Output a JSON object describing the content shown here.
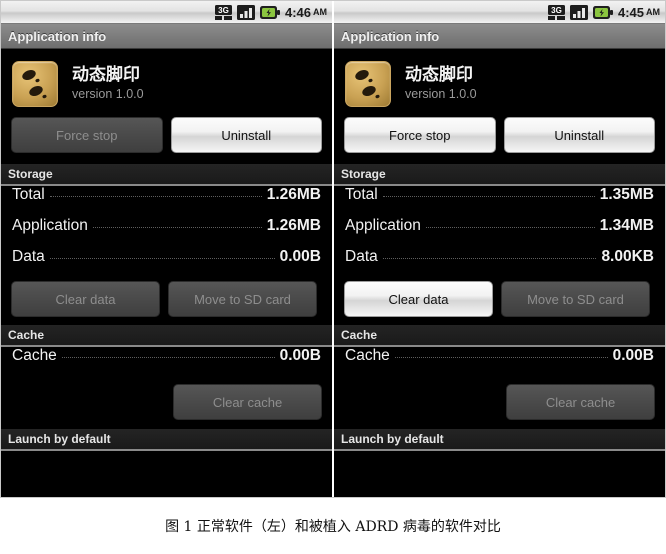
{
  "caption": {
    "text": "图 1 正常软件（左）和被植入 ADRD 病毒的软件对比",
    "figure_number": "图 1",
    "virus_name": "ADRD"
  },
  "panels": [
    {
      "role": "clean-app",
      "statusbar": {
        "network_icon": "3g-icon",
        "signal_icon": "signal-bars-icon",
        "battery_icon": "battery-charging-icon",
        "time": "4:46",
        "ampm": "AM"
      },
      "titlebar": {
        "title": "Application info"
      },
      "app": {
        "icon": "footprint-app-icon",
        "name": "动态脚印",
        "version": "version 1.0.0"
      },
      "actions": [
        {
          "label": "Force stop",
          "enabled": false
        },
        {
          "label": "Uninstall",
          "enabled": true
        }
      ],
      "storage": {
        "header": "Storage",
        "rows": [
          {
            "label": "Total",
            "value": "1.26MB"
          },
          {
            "label": "Application",
            "value": "1.26MB"
          },
          {
            "label": "Data",
            "value": "0.00B"
          }
        ],
        "buttons": [
          {
            "label": "Clear data",
            "enabled": false
          },
          {
            "label": "Move to SD card",
            "enabled": false
          }
        ]
      },
      "cache": {
        "header": "Cache",
        "rows": [
          {
            "label": "Cache",
            "value": "0.00B"
          }
        ],
        "buttons": [
          {
            "label": "Clear cache",
            "enabled": false
          }
        ]
      },
      "launch": {
        "header": "Launch by default"
      }
    },
    {
      "role": "infected-app",
      "statusbar": {
        "network_icon": "3g-icon",
        "signal_icon": "signal-bars-icon",
        "battery_icon": "battery-charging-icon",
        "time": "4:45",
        "ampm": "AM"
      },
      "titlebar": {
        "title": "Application info"
      },
      "app": {
        "icon": "footprint-app-icon",
        "name": "动态脚印",
        "version": "version 1.0.0"
      },
      "actions": [
        {
          "label": "Force stop",
          "enabled": true
        },
        {
          "label": "Uninstall",
          "enabled": true
        }
      ],
      "storage": {
        "header": "Storage",
        "rows": [
          {
            "label": "Total",
            "value": "1.35MB"
          },
          {
            "label": "Application",
            "value": "1.34MB"
          },
          {
            "label": "Data",
            "value": "8.00KB"
          }
        ],
        "buttons": [
          {
            "label": "Clear data",
            "enabled": true
          },
          {
            "label": "Move to SD card",
            "enabled": false
          }
        ]
      },
      "cache": {
        "header": "Cache",
        "rows": [
          {
            "label": "Cache",
            "value": "0.00B"
          }
        ],
        "buttons": [
          {
            "label": "Clear cache",
            "enabled": false
          }
        ]
      },
      "launch": {
        "header": "Launch by default"
      }
    }
  ],
  "colors": {
    "screen_bg": "#000000",
    "titlebar": "#7d7d7d",
    "app_icon_bg": "#c9a153",
    "battery_green": "#8bc53f",
    "text_primary": "#f2f2f2",
    "text_secondary": "#9a9a9a",
    "text_disabled": "#8e8e8e"
  }
}
